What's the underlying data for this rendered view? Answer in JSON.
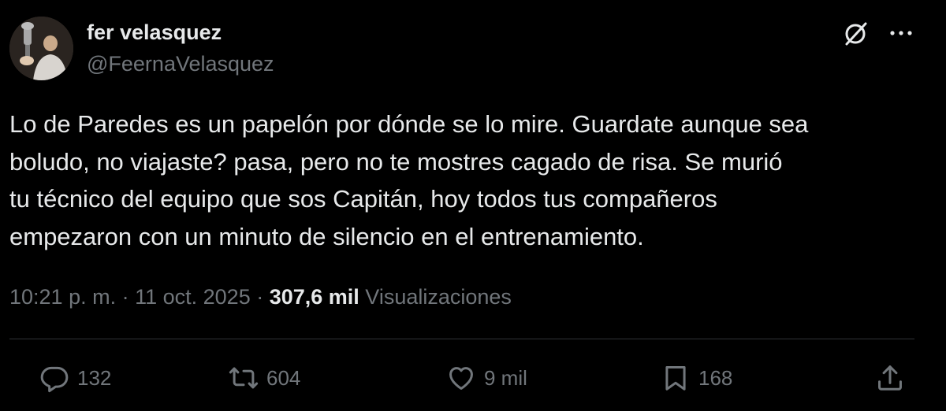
{
  "author": {
    "name": "fer velasquez",
    "handle": "@FeernaVelasquez",
    "avatar_icon": "user-avatar-photo"
  },
  "header_icons": {
    "grok": "grok-icon",
    "more": "more-options-icon"
  },
  "tweet": {
    "lines": [
      "Lo de Paredes es un papelón por dónde se lo mire. Guardate aunque sea",
      "boludo, no viajaste? pasa, pero no te mostres cagado de risa. Se murió",
      "tu técnico del equipo que sos Capitán, hoy todos tus compañeros",
      "empezaron con un minuto de silencio en el entrenamiento."
    ]
  },
  "meta": {
    "time": "10:21 p. m.",
    "separator1": " · ",
    "date": "11 oct. 2025",
    "separator2": " · ",
    "views_count": "307,6 mil",
    "views_label": " Visualizaciones"
  },
  "actions": {
    "reply": {
      "icon": "reply-icon",
      "count": "132"
    },
    "retweet": {
      "icon": "retweet-icon",
      "count": "604"
    },
    "like": {
      "icon": "heart-icon",
      "count": "9 mil"
    },
    "bookmark": {
      "icon": "bookmark-icon",
      "count": "168"
    },
    "share": {
      "icon": "share-icon"
    }
  },
  "colors": {
    "background": "#000000",
    "text_primary": "#e7e9ea",
    "text_secondary": "#71767b",
    "divider": "#2f3336"
  }
}
